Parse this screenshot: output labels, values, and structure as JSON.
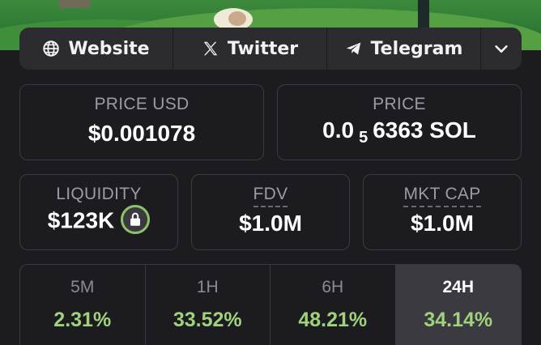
{
  "links": {
    "website": "Website",
    "twitter": "Twitter",
    "telegram": "Telegram"
  },
  "stats": {
    "price_usd": {
      "label": "PRICE USD",
      "value": "$0.001078"
    },
    "price_sol": {
      "label": "PRICE",
      "prefix": "0.0",
      "subscript": "5",
      "rest": "6363 SOL"
    },
    "liquidity": {
      "label": "LIQUIDITY",
      "value": "$123K"
    },
    "fdv": {
      "label": "FDV",
      "value": "$1.0M"
    },
    "mkt_cap": {
      "label": "MKT CAP",
      "value": "$1.0M"
    }
  },
  "timeframes": [
    {
      "label": "5M",
      "change": "2.31%"
    },
    {
      "label": "1H",
      "change": "33.52%"
    },
    {
      "label": "6H",
      "change": "48.21%"
    },
    {
      "label": "24H",
      "change": "34.14%",
      "active": true
    }
  ],
  "colors": {
    "background": "#1c1c20",
    "card_border": "#3a3a40",
    "positive": "#9fd27a",
    "label": "#9b9ba3"
  }
}
